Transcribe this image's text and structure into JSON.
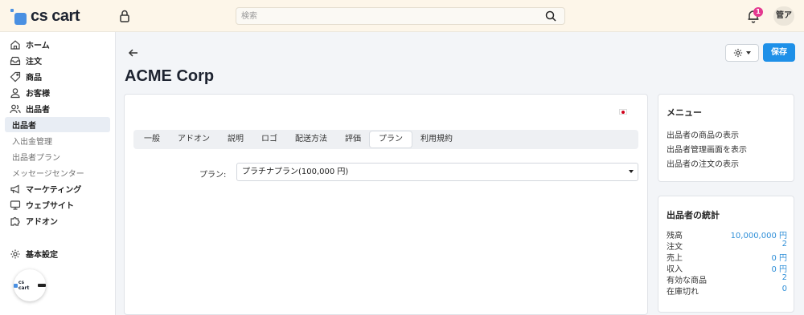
{
  "app": {
    "logo_text": "cs cart"
  },
  "header": {
    "search_placeholder": "検索",
    "notification_count": "1",
    "user_initials": "管ア"
  },
  "sidebar": {
    "items": [
      {
        "label": "ホーム",
        "icon": "home-icon"
      },
      {
        "label": "注文",
        "icon": "inbox-icon"
      },
      {
        "label": "商品",
        "icon": "tag-icon"
      },
      {
        "label": "お客様",
        "icon": "user-icon"
      },
      {
        "label": "出品者",
        "icon": "users-icon"
      },
      {
        "label": "出品者",
        "active": true
      },
      {
        "label": "入出金管理"
      },
      {
        "label": "出品者プラン"
      },
      {
        "label": "メッセージセンター"
      },
      {
        "label": "マーケティング",
        "icon": "megaphone-icon"
      },
      {
        "label": "ウェブサイト",
        "icon": "monitor-icon"
      },
      {
        "label": "アドオン",
        "icon": "puzzle-icon"
      },
      {
        "label": "基本設定",
        "icon": "gear-icon"
      }
    ],
    "widget_label": "cs cart"
  },
  "page": {
    "title": "ACME Corp",
    "save_label": "保存"
  },
  "tabs": [
    "一般",
    "アドオン",
    "説明",
    "ロゴ",
    "配送方法",
    "評価",
    "プラン",
    "利用規約"
  ],
  "active_tab": "プラン",
  "plan_field": {
    "label": "プラン:",
    "value": "プラチナプラン(100,000 円)"
  },
  "menu_card": {
    "title": "メニュー",
    "links": [
      "出品者の商品の表示",
      "出品者管理画面を表示",
      "出品者の注文の表示"
    ]
  },
  "stats_card": {
    "title": "出品者の統計",
    "rows": [
      {
        "label": "残高",
        "value": "10,000,000 円"
      },
      {
        "label": "注文",
        "value": "2"
      },
      {
        "label": "売上",
        "value": "0 円"
      },
      {
        "label": "収入",
        "value": "0 円"
      },
      {
        "label": "有効な商品",
        "value": "2"
      },
      {
        "label": "在庫切れ",
        "value": "0"
      }
    ]
  },
  "colors": {
    "accent": "#1e90e8",
    "header_bg": "#fdf6e9",
    "badge": "#e4398f",
    "link_value": "#2f8fd8"
  }
}
